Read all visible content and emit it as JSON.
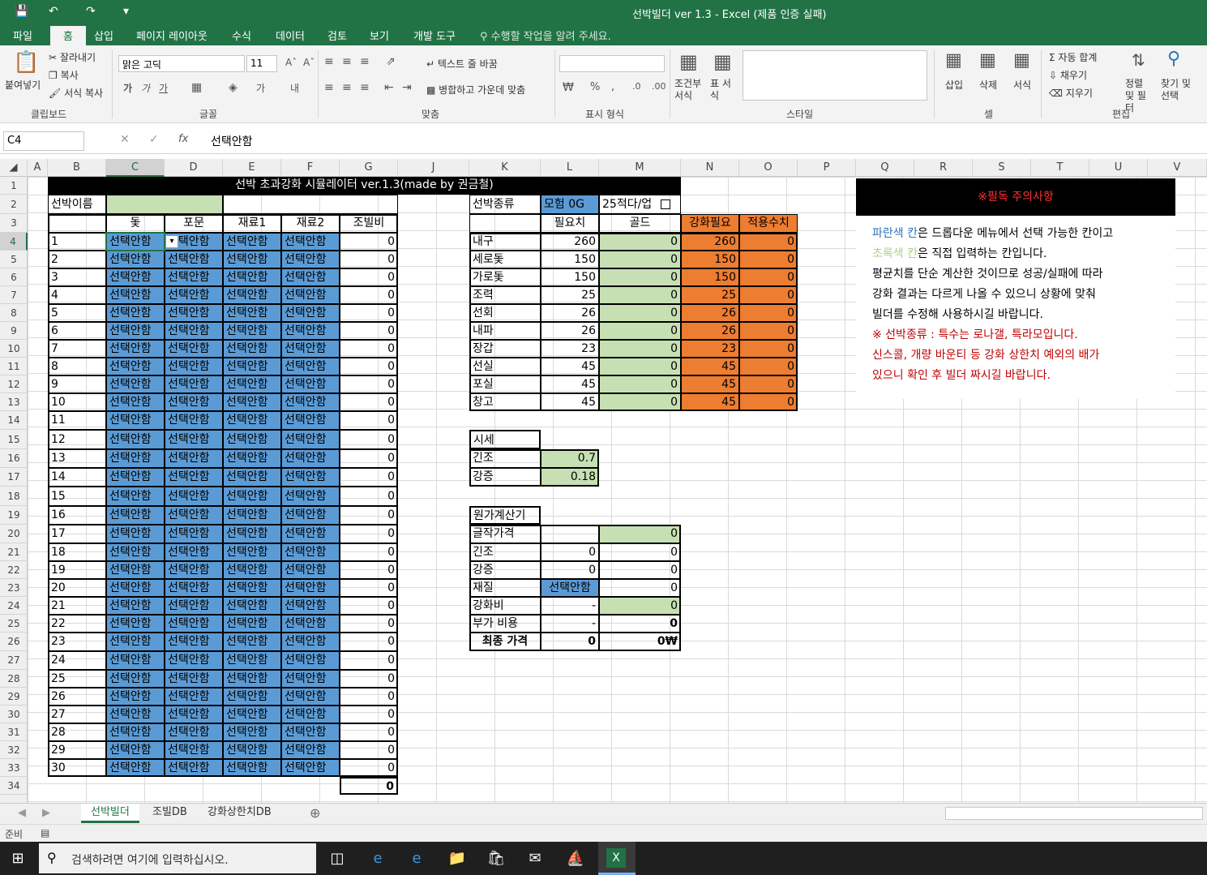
{
  "window": {
    "title": "선박빌더 ver 1.3 - Excel (제품 인증 실패)",
    "quick_access": [
      "save-icon",
      "undo-icon",
      "redo-icon",
      "customize-icon"
    ]
  },
  "tabs": [
    "파일",
    "홈",
    "삽입",
    "페이지 레이아웃",
    "수식",
    "데이터",
    "검토",
    "보기",
    "개발 도구"
  ],
  "active_tab": "홈",
  "tell_me": "수행할 작업을 알려 주세요.",
  "ribbon": {
    "paste": "붙여넣기",
    "cut": "잘라내기",
    "copy": "복사",
    "format_painter": "서식 복사",
    "clipboard": "클립보드",
    "font_name": "맑은 고딕",
    "font_size": "11",
    "font": "글꼴",
    "wrap_text": "텍스트 줄 바꿈",
    "merge_center": "병합하고 가운데 맞춤",
    "alignment": "맞춤",
    "number": "표시 형식",
    "conditional": "조건부 서식",
    "table": "표 서식",
    "styles": "스타일",
    "insert": "삽입",
    "delete": "삭제",
    "format": "서식",
    "cells": "셀",
    "autosum": "자동 합계",
    "fill": "채우기",
    "clear": "지우기",
    "sort": "정렬 및 필터",
    "find": "찾기 및 선택",
    "editing": "편집"
  },
  "formula_bar": {
    "name_box": "C4",
    "formula": "선택안함"
  },
  "columns": [
    "A",
    "B",
    "C",
    "D",
    "E",
    "F",
    "G",
    "J",
    "K",
    "L",
    "M",
    "N",
    "O",
    "P",
    "Q",
    "R",
    "S",
    "T",
    "U",
    "V"
  ],
  "selected_column": "C",
  "selected_row": "4",
  "sheet": {
    "title": "선박 초과강화 시뮬레이터 ver.1.3(made by 권금철)",
    "name_label": "선박이름",
    "name_value": "",
    "headers": [
      "돛",
      "포문",
      "재료1",
      "재료2",
      "조빌비"
    ],
    "default_choice": "선택안함",
    "row_numbers": [
      "1",
      "2",
      "3",
      "4",
      "5",
      "6",
      "7",
      "8",
      "9",
      "10",
      "11",
      "12",
      "13",
      "14",
      "15",
      "16",
      "17",
      "18",
      "19",
      "20",
      "21",
      "22",
      "23",
      "24",
      "25",
      "26",
      "27",
      "28",
      "29",
      "30"
    ],
    "row_costs": [
      "0",
      "0",
      "0",
      "0",
      "0",
      "0",
      "0",
      "0",
      "0",
      "0",
      "0",
      "0",
      "0",
      "0",
      "0",
      "0",
      "0",
      "0",
      "0",
      "0",
      "0",
      "0",
      "0",
      "0",
      "0",
      "0",
      "0",
      "0",
      "0",
      "0"
    ],
    "total_cost": "0",
    "ship_type_label": "선박종류",
    "ship_type_value": "모험 0G",
    "upgrade_label": "25적다/업",
    "stat_headers": [
      "필요치",
      "골드",
      "강화필요",
      "적용수치"
    ],
    "stats": [
      {
        "name": "내구",
        "need": "260",
        "gold": "0",
        "req": "260",
        "applied": "0"
      },
      {
        "name": "세로돛",
        "need": "150",
        "gold": "0",
        "req": "150",
        "applied": "0"
      },
      {
        "name": "가로돛",
        "need": "150",
        "gold": "0",
        "req": "150",
        "applied": "0"
      },
      {
        "name": "조력",
        "need": "25",
        "gold": "0",
        "req": "25",
        "applied": "0"
      },
      {
        "name": "선회",
        "need": "26",
        "gold": "0",
        "req": "26",
        "applied": "0"
      },
      {
        "name": "내파",
        "need": "26",
        "gold": "0",
        "req": "26",
        "applied": "0"
      },
      {
        "name": "장갑",
        "need": "23",
        "gold": "0",
        "req": "23",
        "applied": "0"
      },
      {
        "name": "선실",
        "need": "45",
        "gold": "0",
        "req": "45",
        "applied": "0"
      },
      {
        "name": "포실",
        "need": "45",
        "gold": "0",
        "req": "45",
        "applied": "0"
      },
      {
        "name": "창고",
        "need": "45",
        "gold": "0",
        "req": "45",
        "applied": "0"
      }
    ],
    "market_label": "시세",
    "market": [
      {
        "name": "긴조",
        "value": "0.7"
      },
      {
        "name": "강증",
        "value": "0.18"
      }
    ],
    "cost_calc_label": "원가계산기",
    "cost_rows": [
      {
        "name": "글작가격",
        "a": "",
        "b": "0"
      },
      {
        "name": "긴조",
        "a": "0",
        "b": "0"
      },
      {
        "name": "강증",
        "a": "0",
        "b": "0"
      },
      {
        "name": "재질",
        "a": "선택안함",
        "b": "0"
      },
      {
        "name": "강화비",
        "a": "-",
        "b": "0"
      },
      {
        "name": "부가 비용",
        "a": "-",
        "b": "0"
      }
    ],
    "final_label": "최종 가격",
    "final_a": "0",
    "final_b": "0₩",
    "notice_title": "※필독 주의사항",
    "notice_lines": [
      {
        "prefix": "파란색 칸",
        "text": "은 드롭다운 메뉴에서 선택 가능한 칸이고",
        "color": "#2e75b6"
      },
      {
        "prefix": "초록색 칸",
        "text": "은 직접 입력하는 칸입니다.",
        "color": "#a9d08e"
      },
      {
        "prefix": "",
        "text": "평균치를 단순 계산한 것이므로 성공/실패에 따라",
        "color": "#000"
      },
      {
        "prefix": "",
        "text": "강화 결과는 다르게 나올 수 있으니 상황에 맞춰",
        "color": "#000"
      },
      {
        "prefix": "",
        "text": "빌더를 수정해 사용하시길 바랍니다.",
        "color": "#000"
      },
      {
        "prefix": "",
        "text": "※ 선박종류 : 특수는 로나갤, 특라모입니다.",
        "color": "#c00000"
      },
      {
        "prefix": "",
        "text": "신스콜, 개량 바운티 등 강화 상한치 예외의 배가",
        "color": "#c00000"
      },
      {
        "prefix": "",
        "text": "있으니 확인 후 빌더 짜시길 바랍니다.",
        "color": "#c00000"
      }
    ]
  },
  "sheet_tabs": [
    "선박빌더",
    "조빌DB",
    "강화상한치DB"
  ],
  "active_sheet": "선박빌더",
  "status": "준비",
  "taskbar": {
    "search": "검색하려면 여기에 입력하십시오."
  },
  "colors": {
    "excel_green": "#217346",
    "blue_cell": "#5b9bd5",
    "green_cell": "#c6e0b4",
    "orange_cell": "#ed7d31"
  }
}
